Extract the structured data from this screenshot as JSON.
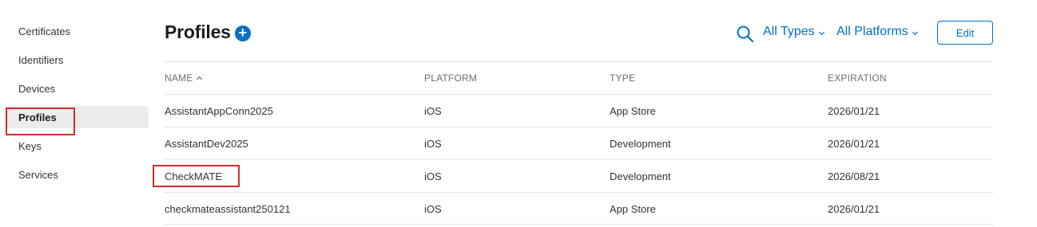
{
  "sidebar": {
    "items": [
      {
        "label": "Certificates"
      },
      {
        "label": "Identifiers"
      },
      {
        "label": "Devices"
      },
      {
        "label": "Profiles"
      },
      {
        "label": "Keys"
      },
      {
        "label": "Services"
      }
    ],
    "active_index": 3
  },
  "header": {
    "title": "Profiles",
    "add_symbol": "+",
    "filter_types": "All Types",
    "filter_platforms": "All Platforms",
    "edit_label": "Edit"
  },
  "table": {
    "columns": [
      "NAME",
      "PLATFORM",
      "TYPE",
      "EXPIRATION"
    ],
    "sort_column": "NAME",
    "sort_direction": "ascending",
    "rows": [
      {
        "name": "AssistantAppConn2025",
        "platform": "iOS",
        "type": "App Store",
        "expiration": "2026/01/21"
      },
      {
        "name": "AssistantDev2025",
        "platform": "iOS",
        "type": "Development",
        "expiration": "2026/01/21"
      },
      {
        "name": "CheckMATE",
        "platform": "iOS",
        "type": "Development",
        "expiration": "2026/08/21"
      },
      {
        "name": "checkmateassistant250121",
        "platform": "iOS",
        "type": "App Store",
        "expiration": "2026/01/21"
      }
    ]
  },
  "colors": {
    "accent": "#0070c9",
    "highlight": "#d62a2e",
    "active_bg": "#ececee"
  },
  "icons": {
    "search": "search-icon",
    "add": "plus-circle-icon",
    "chevron": "chevron-down-icon",
    "sort": "chevron-up-icon"
  }
}
